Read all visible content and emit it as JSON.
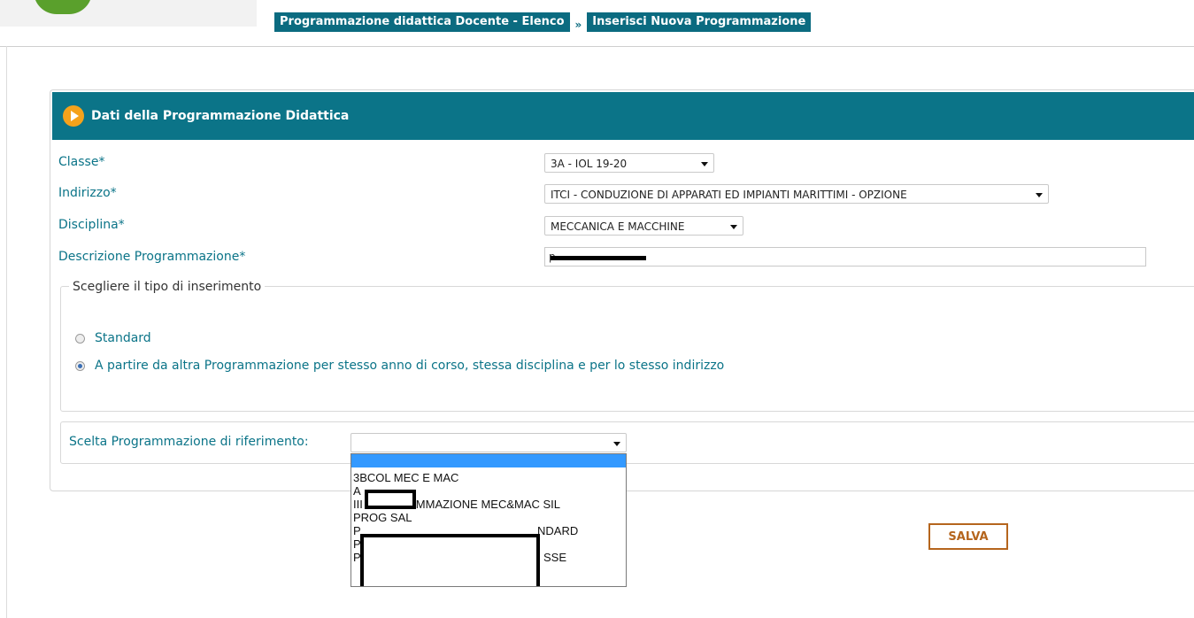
{
  "breadcrumb": {
    "items": [
      "Programmazione didattica Docente - Elenco",
      "Inserisci Nuova Programmazione"
    ],
    "separator": "»"
  },
  "panel": {
    "title": "Dati della Programmazione Didattica"
  },
  "form": {
    "classe_label": "Classe*",
    "classe_value": "3A - IOL 19-20",
    "indirizzo_label": "Indirizzo*",
    "indirizzo_value": "ITCI - CONDUZIONE DI APPARATI ED IMPIANTI MARITTIMI - OPZIONE",
    "disciplina_label": "Disciplina*",
    "disciplina_value": "MECCANICA E MACCHINE",
    "descrizione_label": "Descrizione Programmazione*",
    "descrizione_value_visible": "p"
  },
  "insert_type": {
    "legend": "Scegliere il tipo di inserimento",
    "options": [
      {
        "label": "Standard",
        "checked": false
      },
      {
        "label": "A partire da altra Programmazione per stesso anno di corso, stessa disciplina e per lo stesso indirizzo",
        "checked": true
      }
    ]
  },
  "reference": {
    "label": "Scelta Programmazione di riferimento:",
    "selected_value": "",
    "options": [
      "",
      "3BCOL MEC E MAC",
      "A",
      "III PROGRAMMAZIONE MEC&MAC SIL",
      "PROG SAL",
      "P",
      "P",
      "P"
    ],
    "partial_suffixes": [
      "NDARD",
      "SSE"
    ]
  },
  "actions": {
    "save_label": "SALVA"
  },
  "colors": {
    "teal": "#0b7488",
    "orange": "#f5a21b",
    "save_border": "#b5651d",
    "selected_option": "#3399ff"
  }
}
